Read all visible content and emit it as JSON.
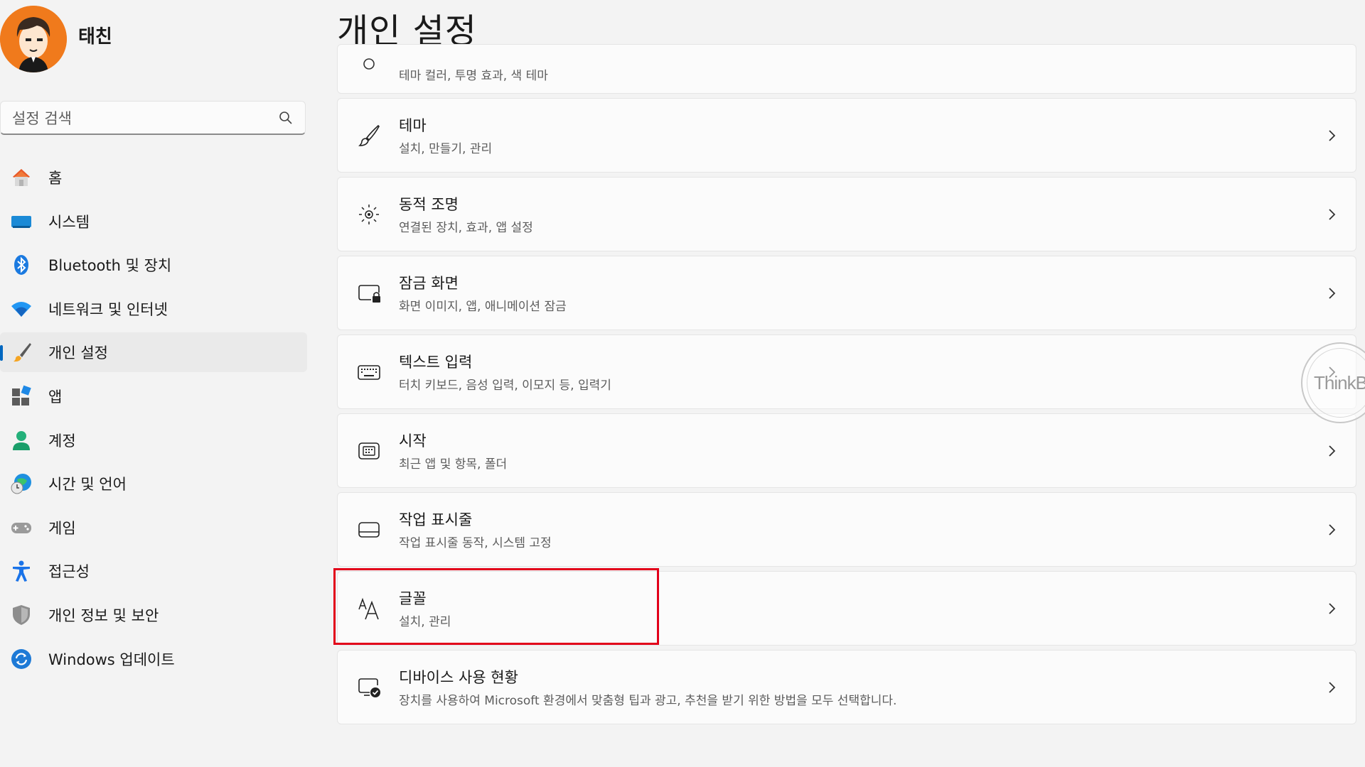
{
  "profile": {
    "name": "태친"
  },
  "search": {
    "placeholder": "설정 검색"
  },
  "nav": [
    {
      "label": "홈",
      "icon": "home-icon"
    },
    {
      "label": "시스템",
      "icon": "system-icon"
    },
    {
      "label": "Bluetooth 및 장치",
      "icon": "bluetooth-icon"
    },
    {
      "label": "네트워크 및 인터넷",
      "icon": "wifi-icon"
    },
    {
      "label": "개인 설정",
      "icon": "brush-icon",
      "active": true
    },
    {
      "label": "앱",
      "icon": "apps-icon"
    },
    {
      "label": "계정",
      "icon": "account-icon"
    },
    {
      "label": "시간 및 언어",
      "icon": "globe-clock-icon"
    },
    {
      "label": "게임",
      "icon": "gamepad-icon"
    },
    {
      "label": "접근성",
      "icon": "accessibility-icon"
    },
    {
      "label": "개인 정보 및 보안",
      "icon": "shield-icon"
    },
    {
      "label": "Windows 업데이트",
      "icon": "update-icon"
    }
  ],
  "main": {
    "title": "개인 설정",
    "cards": [
      {
        "title": "",
        "sub": "테마 컬러, 투명 효과, 색 테마",
        "icon": "color-icon"
      },
      {
        "title": "테마",
        "sub": "설치, 만들기, 관리",
        "icon": "brush-icon"
      },
      {
        "title": "동적 조명",
        "sub": "연결된 장치, 효과, 앱 설정",
        "icon": "dynamic-lighting-icon"
      },
      {
        "title": "잠금 화면",
        "sub": "화면 이미지, 앱, 애니메이션 잠금",
        "icon": "lock-screen-icon"
      },
      {
        "title": "텍스트 입력",
        "sub": "터치 키보드, 음성 입력, 이모지 등, 입력기",
        "icon": "keyboard-icon"
      },
      {
        "title": "시작",
        "sub": "최근 앱 및 항목, 폴더",
        "icon": "start-icon"
      },
      {
        "title": "작업 표시줄",
        "sub": "작업 표시줄 동작, 시스템 고정",
        "icon": "taskbar-icon"
      },
      {
        "title": "글꼴",
        "sub": "설치, 관리",
        "icon": "fonts-icon"
      },
      {
        "title": "디바이스 사용 현황",
        "sub": "장치를 사용하여 Microsoft 환경에서 맞춤형 팁과 광고, 추천을 받기 위한 방법을 모두 선택합니다.",
        "icon": "device-usage-icon"
      }
    ]
  },
  "overlay": {
    "brand": "ThinkBook"
  },
  "colors": {
    "accent": "#0067c0",
    "highlight": "#e2001a",
    "avatar_bg": "#f07a1c"
  }
}
